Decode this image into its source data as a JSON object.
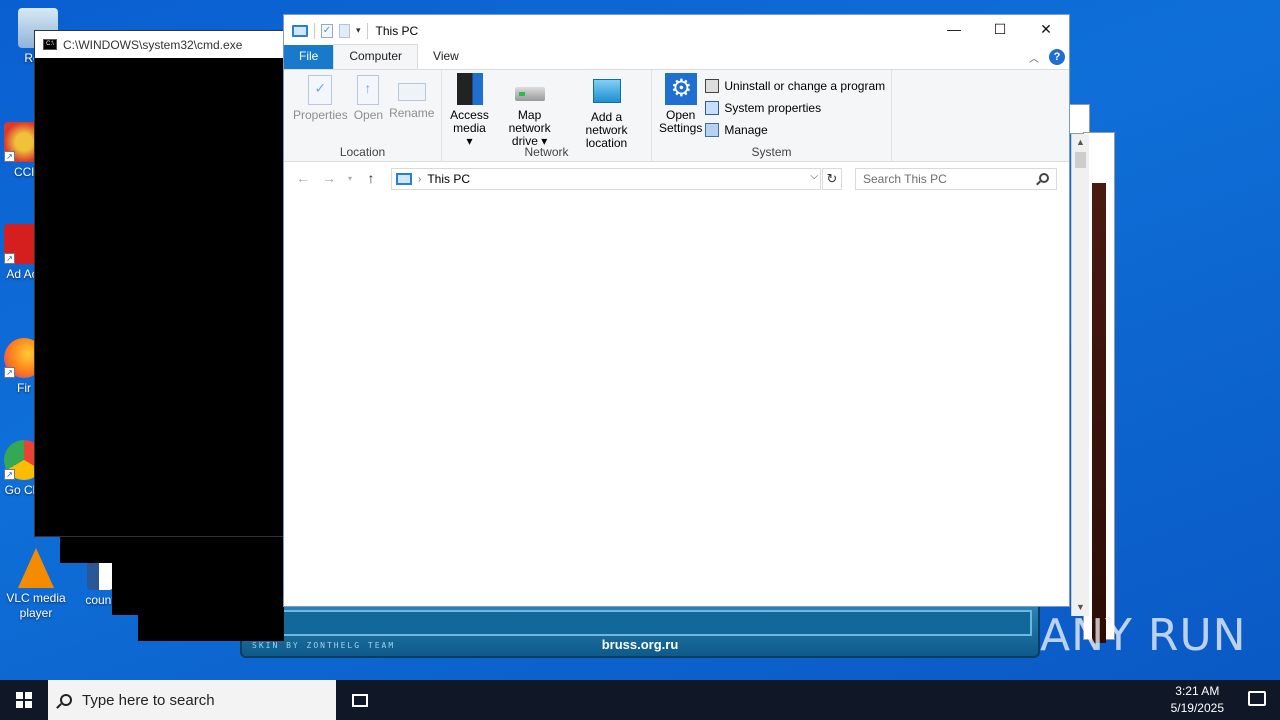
{
  "desktop": {
    "icons": [
      {
        "label": "Recy",
        "color": "#8fb4d8"
      },
      {
        "label": "CCl",
        "color": "#d9392f"
      },
      {
        "label": "Ad Acr",
        "color": "#d51e1e"
      },
      {
        "label": "Fir",
        "color": "#ff7a1a"
      },
      {
        "label": "Go Chr",
        "color": "#34a853"
      },
      {
        "label": "VLC media player",
        "color": "#f48b00"
      },
      {
        "label": "count",
        "color": "#2b5797"
      }
    ]
  },
  "skin_window": {
    "credit": "SKIN BY ZONTHELG TEAM",
    "site": "bruss.org.ru"
  },
  "cmd": {
    "title": "C:\\WINDOWS\\system32\\cmd.exe",
    "icon_text": "C:\\"
  },
  "explorer": {
    "title": "This PC",
    "caption": {
      "minimize": "—",
      "maximize": "☐",
      "close": "✕"
    },
    "tabs": {
      "file": "File",
      "computer": "Computer",
      "view": "View"
    },
    "help": "?",
    "ribbon": {
      "location": {
        "label": "Location",
        "properties": "Properties",
        "open": "Open",
        "rename": "Rename"
      },
      "network": {
        "label": "Network",
        "access_media_1": "Access",
        "access_media_2": "media ▾",
        "map_drive_1": "Map network",
        "map_drive_2": "drive ▾",
        "add_location_1": "Add a network",
        "add_location_2": "location"
      },
      "system": {
        "label": "System",
        "open_settings_1": "Open",
        "open_settings_2": "Settings",
        "uninstall": "Uninstall or change a program",
        "system_properties": "System properties",
        "manage": "Manage"
      }
    },
    "address": {
      "path": "This PC"
    },
    "search": {
      "placeholder": "Search This PC"
    }
  },
  "watermark": "ANY RUN",
  "taskbar": {
    "search_placeholder": "Type here to search",
    "time": "3:21 AM",
    "date": "5/19/2025"
  }
}
